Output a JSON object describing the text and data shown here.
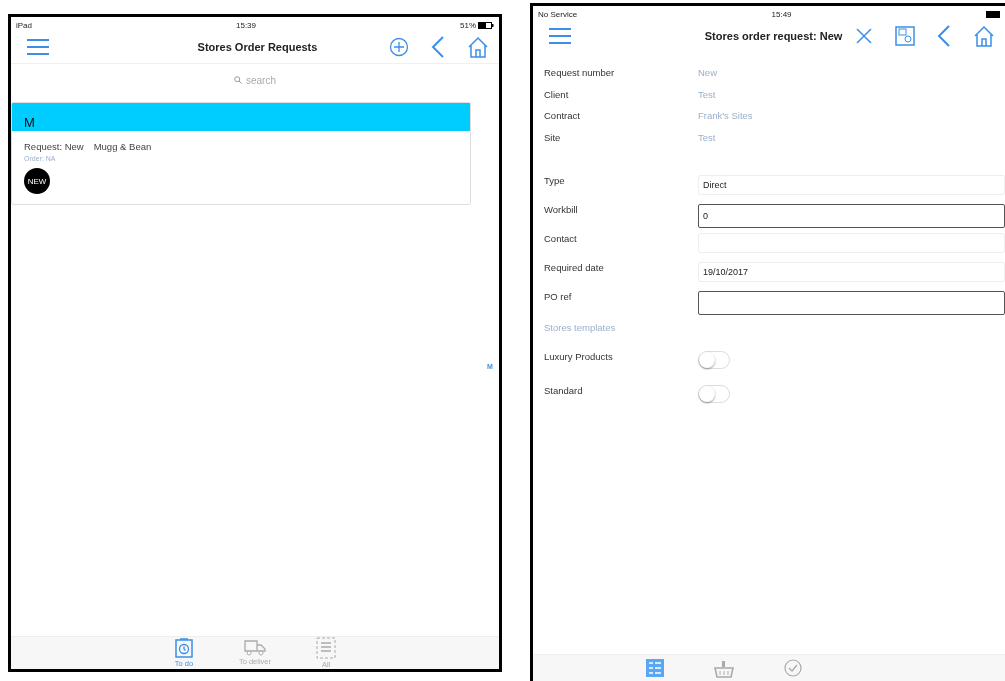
{
  "left_screen": {
    "status_bar": {
      "carrier": "iPad",
      "time": "15:39",
      "battery": "51%"
    },
    "title": "Stores Order Requests",
    "search": {
      "placeholder": "search"
    },
    "sections": [
      {
        "header": "M",
        "items": [
          {
            "request": "Request: New",
            "client": "Mugg & Bean",
            "order": "Order: NA",
            "badge": "NEW"
          }
        ]
      }
    ],
    "index_letters": [
      "M"
    ],
    "tabs": [
      {
        "kind": "clock",
        "label": "To do",
        "selected": true
      },
      {
        "kind": "truck",
        "label": "To deliver",
        "selected": false
      },
      {
        "kind": "list",
        "label": "All",
        "selected": false
      }
    ]
  },
  "right_screen": {
    "status_bar": {
      "carrier": "No Service",
      "time": "15:49"
    },
    "title": "Stores order request: New",
    "info_rows": [
      {
        "label": "Request number",
        "value": "New"
      },
      {
        "label": "Client",
        "value": "Test"
      },
      {
        "label": "Contract",
        "value": "Frank's Sites"
      },
      {
        "label": "Site",
        "value": "Test"
      }
    ],
    "fields": [
      {
        "label": "Type",
        "value": "Direct",
        "outlined": false
      },
      {
        "label": "Workbill",
        "value": "0",
        "outlined": true
      },
      {
        "label": "Contact",
        "outlined": false
      },
      {
        "label": "Required date",
        "value": "19/10/2017",
        "outlined": false
      },
      {
        "label": "PO ref",
        "outlined": true
      }
    ],
    "templates_heading": "Stores templates",
    "toggles": [
      {
        "label": "Luxury Products",
        "on": false
      },
      {
        "label": "Standard",
        "on": false
      }
    ],
    "tabs": [
      {
        "kind": "form",
        "selected": true
      },
      {
        "kind": "basket",
        "selected": false
      },
      {
        "kind": "check",
        "selected": false
      }
    ]
  }
}
